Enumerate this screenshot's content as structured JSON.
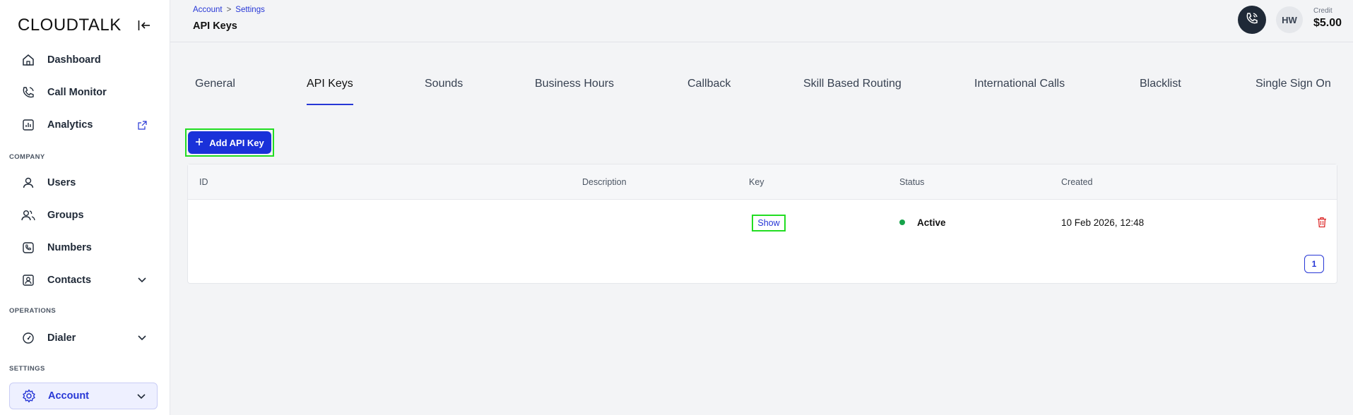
{
  "sidebar": {
    "logo": "CLOUDTALK",
    "items": {
      "dashboard": "Dashboard",
      "call_monitor": "Call Monitor",
      "analytics": "Analytics",
      "users": "Users",
      "groups": "Groups",
      "numbers": "Numbers",
      "contacts": "Contacts",
      "dialer": "Dialer",
      "account": "Account"
    },
    "sections": {
      "company": "COMPANY",
      "operations": "OPERATIONS",
      "settings": "SETTINGS"
    }
  },
  "header": {
    "breadcrumb": [
      "Account",
      ">",
      "Settings"
    ],
    "title": "API Keys",
    "avatar_initials": "HW",
    "credit_label": "Credit",
    "credit_value": "$5.00"
  },
  "tabs": [
    "General",
    "API Keys",
    "Sounds",
    "Business Hours",
    "Callback",
    "Skill Based Routing",
    "International Calls",
    "Blacklist",
    "Single Sign On"
  ],
  "active_tab": "API Keys",
  "add_button_label": "Add API Key",
  "table": {
    "columns": [
      "ID",
      "Description",
      "Key",
      "Status",
      "Created"
    ],
    "rows": [
      {
        "id": "",
        "description": "",
        "key_action": "Show",
        "status": "Active",
        "created": "10 Feb 2026, 12:48"
      }
    ]
  },
  "pagination": {
    "current_page": "1"
  },
  "colors": {
    "accent": "#1a31d9",
    "status_active": "#16a34a",
    "delete": "#dc2626"
  }
}
